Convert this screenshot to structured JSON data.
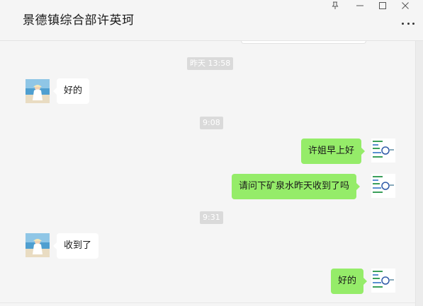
{
  "header": {
    "title": "景德镇综合部许英珂",
    "controls": {
      "pin": "pin-icon",
      "minimize": "minimize-icon",
      "maximize": "maximize-icon",
      "close": "close-icon",
      "more": "more-icon"
    }
  },
  "chat": {
    "timestamps": [
      "昨天 13:58",
      "9:08",
      "9:31"
    ],
    "messages": [
      {
        "direction": "in",
        "text": "好的"
      },
      {
        "direction": "out",
        "text": "许姐早上好"
      },
      {
        "direction": "out",
        "text": "请问下矿泉水昨天收到了吗"
      },
      {
        "direction": "in",
        "text": "收到了"
      },
      {
        "direction": "out",
        "text": "好的"
      }
    ]
  },
  "colors": {
    "background": "#f5f5f5",
    "bubble_out": "#95ec69",
    "bubble_in": "#ffffff",
    "timestamp_bg": "#dadada"
  }
}
